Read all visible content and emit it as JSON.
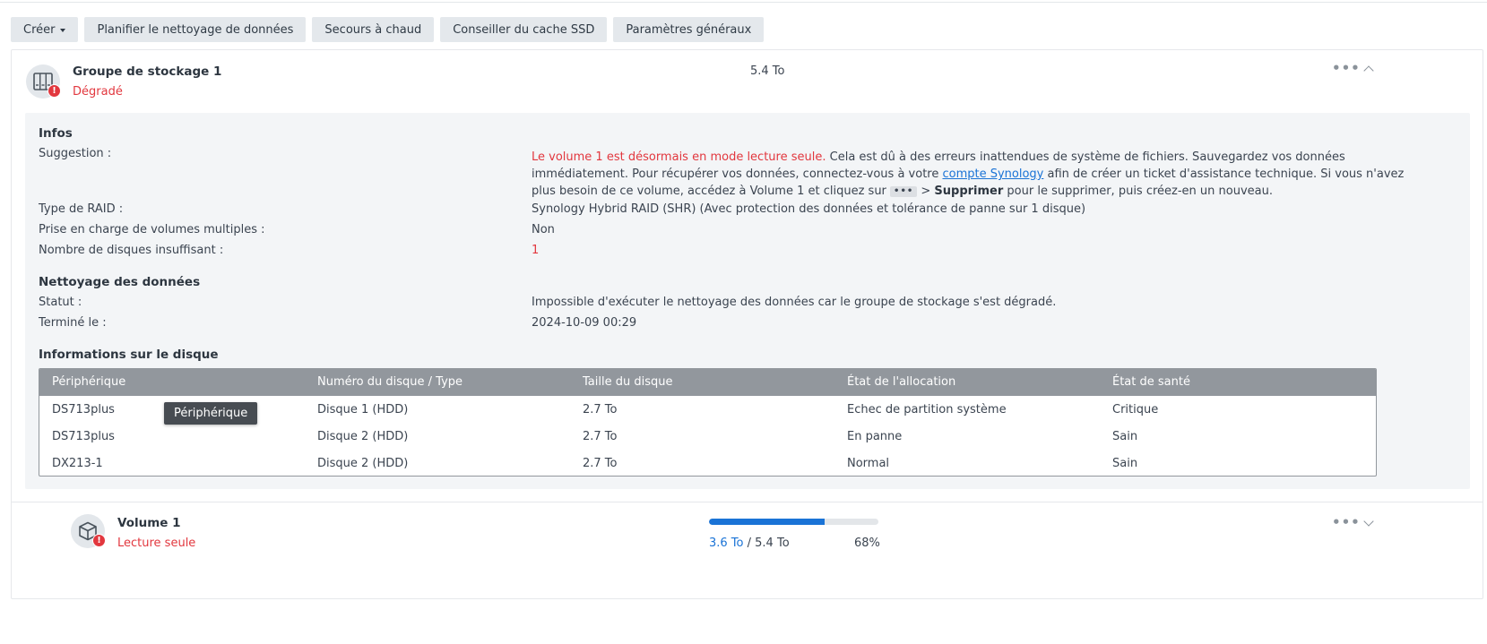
{
  "toolbar": {
    "create_label": "Créer",
    "schedule_label": "Planifier le nettoyage de données",
    "hot_spare_label": "Secours à chaud",
    "ssd_cache_label": "Conseiller du cache SSD",
    "general_settings_label": "Paramètres généraux"
  },
  "pool": {
    "title": "Groupe de stockage 1",
    "status": "Dégradé",
    "size": "5.4 To",
    "status_color": "#e2373e",
    "icon": "storage-pool-icon"
  },
  "infos": {
    "title": "Infos",
    "suggestion_label": "Suggestion :",
    "suggestion_warning": "Le volume 1 est désormais en mode lecture seule.",
    "suggestion_part1": " Cela est dû à des erreurs inattendues de système de fichiers. Sauvegardez vos données immédiatement. Pour récupérer vos données, connectez-vous à votre ",
    "suggestion_link": "compte Synology",
    "suggestion_part2": " afin de créer un ticket d'assistance technique. Si vous n'avez plus besoin de ce volume, accédez à Volume 1 et cliquez sur ",
    "suggestion_dots": "•••",
    "suggestion_part3": " > ",
    "suggestion_delete": "Supprimer",
    "suggestion_part4": " pour le supprimer, puis créez-en un nouveau.",
    "raid_label": "Type de RAID :",
    "raid_value": "Synology Hybrid RAID (SHR) (Avec protection des données et tolérance de panne sur 1 disque)",
    "multi_volume_label": "Prise en charge de volumes multiples :",
    "multi_volume_value": "Non",
    "missing_disks_label": "Nombre de disques insuffisant :",
    "missing_disks_value": "1"
  },
  "scrubbing": {
    "title": "Nettoyage des données",
    "status_label": "Statut :",
    "status_value": "Impossible d'exécuter le nettoyage des données car le groupe de stockage s'est dégradé.",
    "finished_label": "Terminé le :",
    "finished_value": "2024-10-09 00:29"
  },
  "disks": {
    "title": "Informations sur le disque",
    "headers": [
      "Périphérique",
      "Numéro du disque / Type",
      "Taille du disque",
      "État de l'allocation",
      "État de santé"
    ],
    "rows": [
      {
        "device": "DS713plus",
        "disk": "Disque 1 (HDD)",
        "size": "2.7 To",
        "allocation": "Echec de partition système",
        "health": "Critique"
      },
      {
        "device": "DS713plus",
        "disk": "Disque 2 (HDD)",
        "size": "2.7 To",
        "allocation": "En panne",
        "health": "Sain"
      },
      {
        "device": "DX213-1",
        "disk": "Disque 2 (HDD)",
        "size": "2.7 To",
        "allocation": "Normal",
        "health": "Sain"
      }
    ],
    "tooltip": "Périphérique"
  },
  "volume": {
    "title": "Volume 1",
    "status": "Lecture seule",
    "used": "3.6 To",
    "separator": " / ",
    "total": "5.4 To",
    "percent": "68%",
    "usage_fraction": 0.68,
    "icon": "volume-cube-icon"
  },
  "colors": {
    "error": "#e2373e",
    "ok": "#1a9e2b",
    "accent": "#1a73d6"
  }
}
